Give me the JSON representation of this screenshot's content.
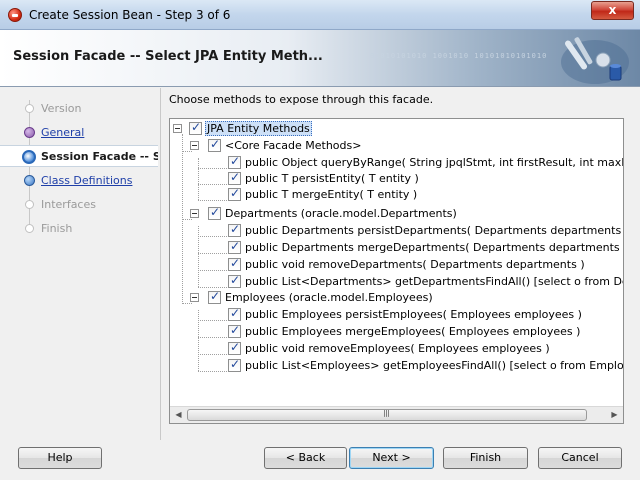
{
  "window": {
    "title": "Create Session Bean - Step 3 of 6",
    "close_label": "x"
  },
  "header": {
    "title": "Session Facade -- Select JPA Entity Meth...",
    "decoration_text": "01010101010 1001010 10101010101010"
  },
  "nav": {
    "items": [
      {
        "label": "Version",
        "state": "disabled"
      },
      {
        "label": "General",
        "state": "done"
      },
      {
        "label": "Session Facade -- Se",
        "state": "current"
      },
      {
        "label": "Class Definitions",
        "state": "link"
      },
      {
        "label": "Interfaces",
        "state": "disabled"
      },
      {
        "label": "Finish",
        "state": "disabled"
      }
    ]
  },
  "main": {
    "instruction": "Choose methods to expose through this facade.",
    "tree": {
      "root": "JPA Entity Methods",
      "groups": [
        {
          "label": "<Core Facade Methods>",
          "methods": [
            "public Object queryByRange( String jpqlStmt, int firstResult, int maxResults )",
            "public T persistEntity( T entity )",
            "public T mergeEntity( T entity )"
          ]
        },
        {
          "label": "Departments (oracle.model.Departments)",
          "methods": [
            "public Departments persistDepartments( Departments departments )",
            "public Departments mergeDepartments( Departments departments )",
            "public void removeDepartments( Departments departments )",
            "public List<Departments> getDepartmentsFindAll() [select o from Departments"
          ]
        },
        {
          "label": "Employees (oracle.model.Employees)",
          "methods": [
            "public Employees persistEmployees( Employees employees )",
            "public Employees mergeEmployees( Employees employees )",
            "public void removeEmployees( Employees employees )",
            "public List<Employees> getEmployeesFindAll() [select o from Employees o]"
          ]
        }
      ]
    }
  },
  "footer": {
    "help": "Help",
    "back": "< Back",
    "next": "Next >",
    "finish": "Finish",
    "cancel": "Cancel"
  }
}
